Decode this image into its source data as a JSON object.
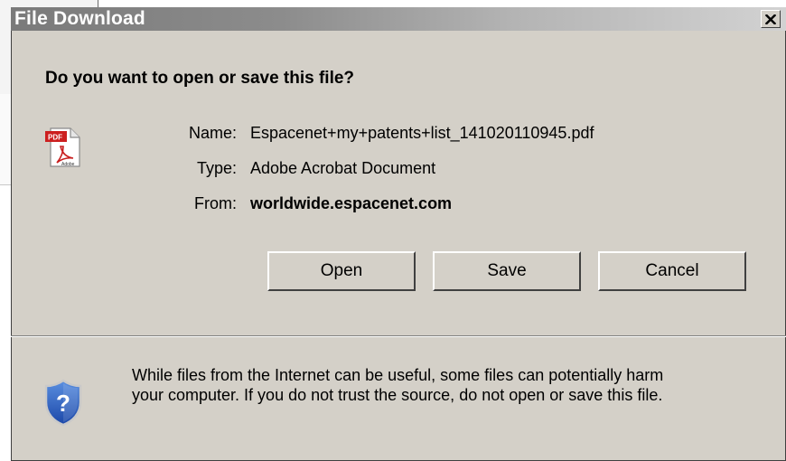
{
  "dialog": {
    "title": "File Download",
    "question": "Do you want to open or save this file?",
    "fields": [
      {
        "label": "Name:",
        "value": "Espacenet+my+patents+list_141020110945.pdf"
      },
      {
        "label": "Type:",
        "value": "Adobe Acrobat Document"
      },
      {
        "label": "From:",
        "value": "worldwide.espacenet.com"
      }
    ],
    "buttons": {
      "open": "Open",
      "save": "Save",
      "cancel": "Cancel"
    },
    "warning_line1": "While files from the Internet can be useful, some files can potentially harm",
    "warning_line2": "your computer. If you do not trust the source, do not open or save this file.",
    "icons": {
      "file": "pdf-file-icon",
      "security": "security-shield-icon",
      "close": "close-icon",
      "pdf_badge": "PDF",
      "pdf_brand": "Adobe"
    }
  }
}
